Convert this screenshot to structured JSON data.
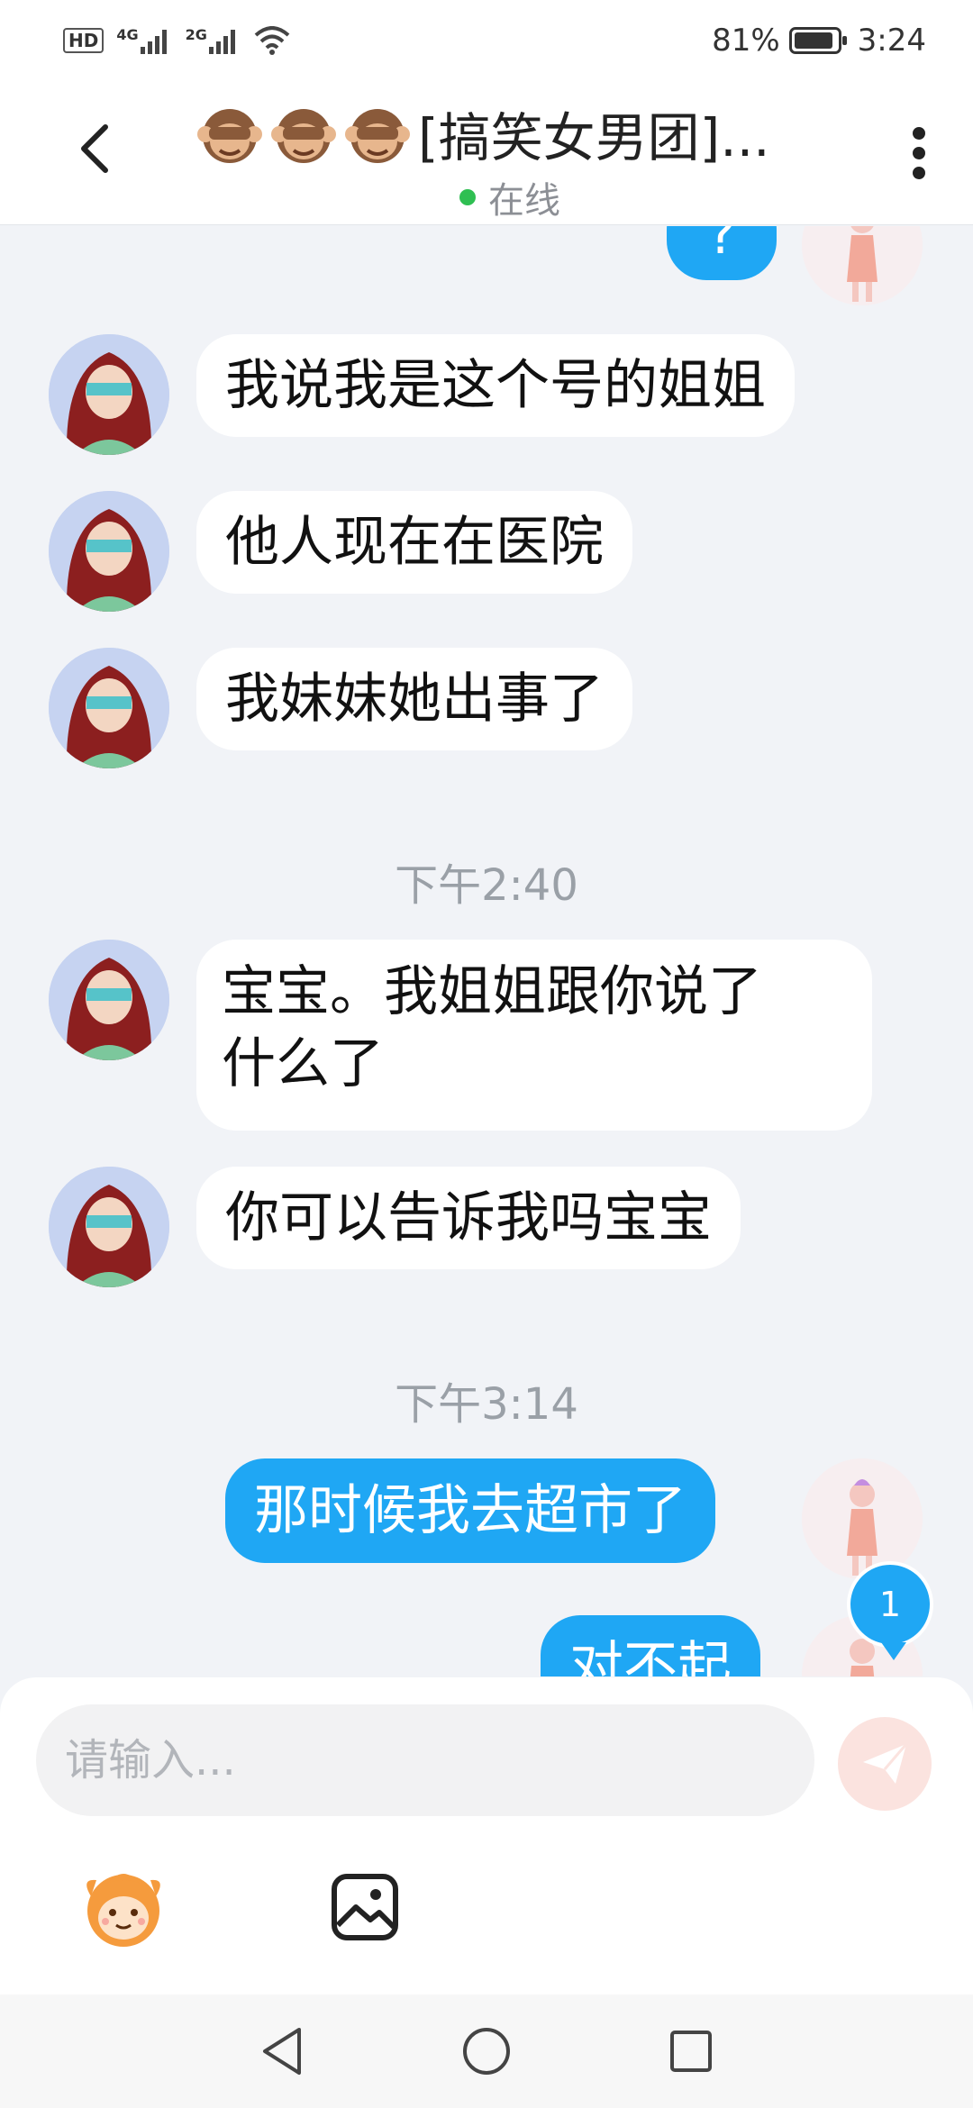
{
  "status_bar": {
    "network_left": "HD",
    "sim1_label": "4G",
    "sim2_label": "2G",
    "battery_percent_text": "81%",
    "battery_level": 0.81,
    "time": "3:24"
  },
  "header": {
    "title": "[搞笑女男团]...",
    "title_emoji": "monkey-see-no-evil",
    "status": "在线"
  },
  "messages": [
    {
      "type": "outgoing",
      "text": "?",
      "avatar": "self-avatar"
    },
    {
      "type": "incoming",
      "text": "我说我是这个号的姐姐",
      "avatar": "contact-avatar"
    },
    {
      "type": "incoming",
      "text": "他人现在在医院",
      "avatar": "contact-avatar"
    },
    {
      "type": "incoming",
      "text": "我妹妹她出事了",
      "avatar": "contact-avatar"
    },
    {
      "type": "time",
      "text": "下午2:40"
    },
    {
      "type": "incoming",
      "text_line1": "宝宝。我姐姐跟你说了",
      "text_line2": "什么了",
      "avatar": "contact-avatar"
    },
    {
      "type": "incoming",
      "text": "你可以告诉我吗宝宝",
      "avatar": "contact-avatar"
    },
    {
      "type": "time",
      "text": "下午3:14"
    },
    {
      "type": "outgoing",
      "text": "那时候我去超市了",
      "avatar": "self-avatar"
    },
    {
      "type": "outgoing",
      "text": "对不起",
      "avatar": "self-avatar"
    }
  ],
  "unread_badge": "1",
  "composer": {
    "placeholder": "请输入..."
  },
  "colors": {
    "accent_blue": "#1fa7f4",
    "online_green": "#2fbf52",
    "background": "#f1f3f7"
  }
}
